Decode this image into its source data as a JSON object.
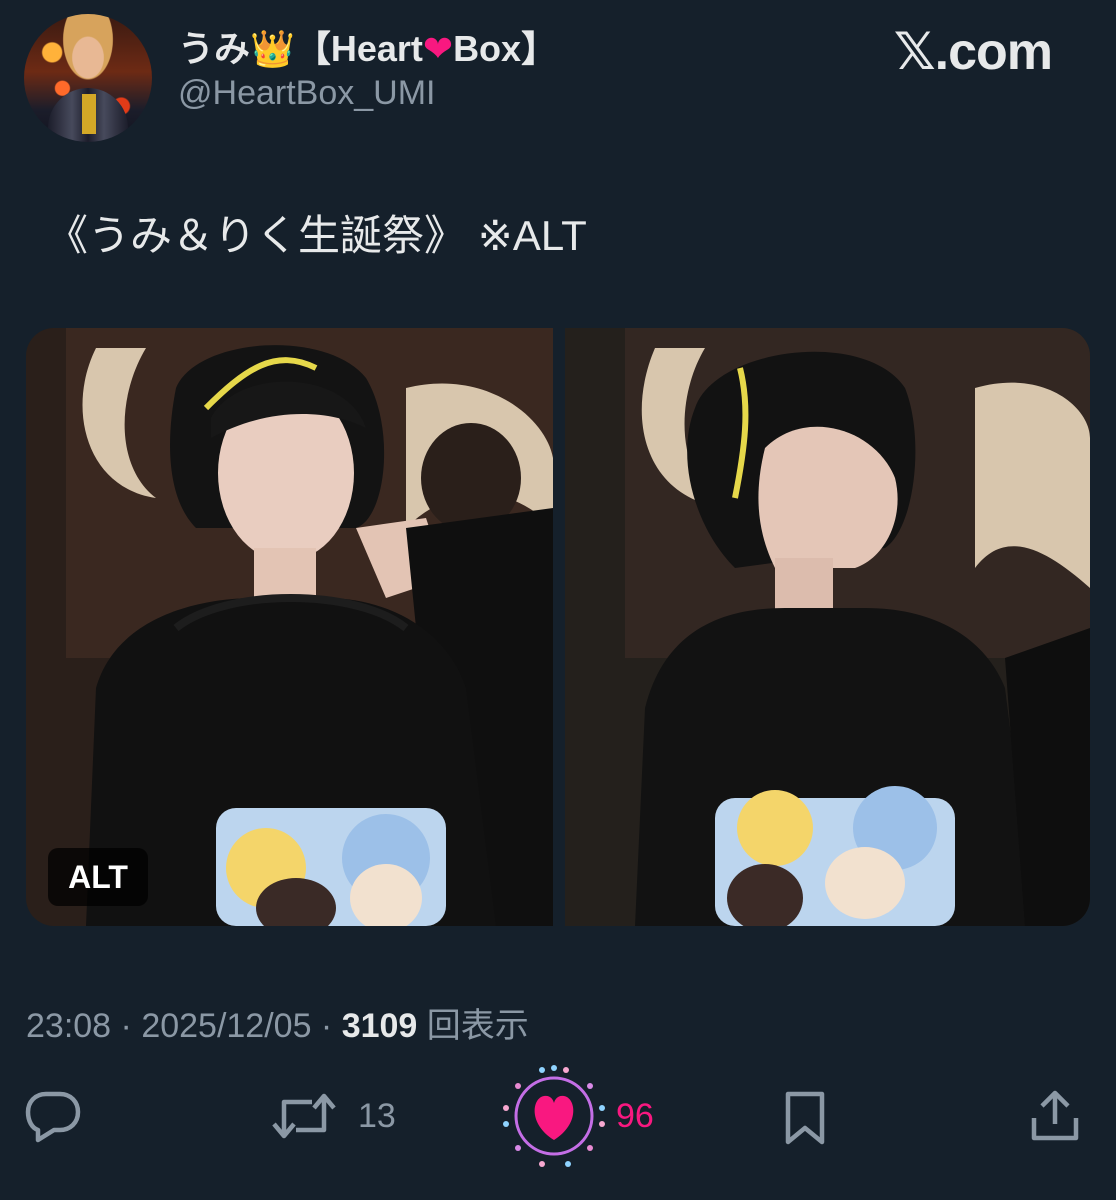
{
  "author": {
    "display_name_prefix": "うみ",
    "crown": "👑",
    "display_name_mid": "【Heart",
    "heart": "❤",
    "display_name_suffix": "Box】",
    "handle": "@HeartBox_UMI"
  },
  "brand": {
    "logo_text": "𝕏.com"
  },
  "tweet": {
    "text": "《うみ＆りく生誕祭》 ※ALT",
    "alt_badge": "ALT",
    "time": "23:08",
    "sep1": " · ",
    "date": "2025/12/05",
    "sep2": " · ",
    "views": "3109",
    "views_label": " 回表示"
  },
  "actions": {
    "reply_icon": "reply-icon",
    "retweet_icon": "retweet-icon",
    "retweet_count": "13",
    "like_icon": "heart-filled-icon",
    "like_count": "96",
    "bookmark_icon": "bookmark-icon",
    "share_icon": "share-icon"
  },
  "colors": {
    "background": "#15202b",
    "text_primary": "#e7e9ea",
    "text_secondary": "#8b98a5",
    "like_pink": "#f91880"
  }
}
